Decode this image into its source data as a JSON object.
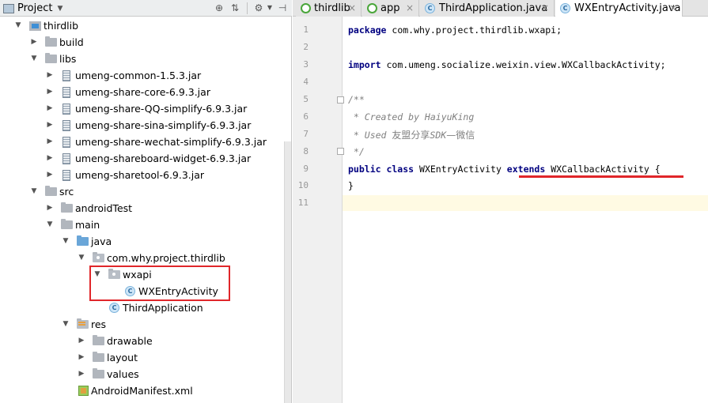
{
  "panel": {
    "title": "Project",
    "dropdown_icon": "caret-down-icon",
    "tools": [
      "target-icon",
      "collapse-icon",
      "gear-icon",
      "hide-icon"
    ]
  },
  "tree": [
    {
      "label": "thirdlib",
      "icon": "module-icon",
      "arrow": "expanded"
    },
    {
      "label": "build",
      "icon": "folder-icon",
      "arrow": "collapsed"
    },
    {
      "label": "libs",
      "icon": "folder-icon",
      "arrow": "expanded"
    },
    {
      "label": "umeng-common-1.5.3.jar",
      "icon": "jar-icon",
      "arrow": "collapsed"
    },
    {
      "label": "umeng-share-core-6.9.3.jar",
      "icon": "jar-icon",
      "arrow": "collapsed"
    },
    {
      "label": "umeng-share-QQ-simplify-6.9.3.jar",
      "icon": "jar-icon",
      "arrow": "collapsed"
    },
    {
      "label": "umeng-share-sina-simplify-6.9.3.jar",
      "icon": "jar-icon",
      "arrow": "collapsed"
    },
    {
      "label": "umeng-share-wechat-simplify-6.9.3.jar",
      "icon": "jar-icon",
      "arrow": "collapsed"
    },
    {
      "label": "umeng-shareboard-widget-6.9.3.jar",
      "icon": "jar-icon",
      "arrow": "collapsed"
    },
    {
      "label": "umeng-sharetool-6.9.3.jar",
      "icon": "jar-icon",
      "arrow": "collapsed"
    },
    {
      "label": "src",
      "icon": "folder-icon",
      "arrow": "expanded"
    },
    {
      "label": "androidTest",
      "icon": "folder-icon",
      "arrow": "collapsed"
    },
    {
      "label": "main",
      "icon": "folder-icon",
      "arrow": "expanded"
    },
    {
      "label": "java",
      "icon": "source-folder-icon",
      "arrow": "expanded"
    },
    {
      "label": "com.why.project.thirdlib",
      "icon": "package-icon",
      "arrow": "expanded"
    },
    {
      "label": "wxapi",
      "icon": "package-icon",
      "arrow": "expanded"
    },
    {
      "label": "WXEntryActivity",
      "icon": "class-icon",
      "arrow": "none"
    },
    {
      "label": "ThirdApplication",
      "icon": "class-icon",
      "arrow": "none"
    },
    {
      "label": "res",
      "icon": "resource-folder-icon",
      "arrow": "expanded"
    },
    {
      "label": "drawable",
      "icon": "folder-icon",
      "arrow": "collapsed"
    },
    {
      "label": "layout",
      "icon": "folder-icon",
      "arrow": "collapsed"
    },
    {
      "label": "values",
      "icon": "folder-icon",
      "arrow": "collapsed"
    },
    {
      "label": "AndroidManifest.xml",
      "icon": "manifest-icon",
      "arrow": "none"
    }
  ],
  "tabs": [
    {
      "label": "thirdlib",
      "icon": "module-tab-icon",
      "active": false
    },
    {
      "label": "app",
      "icon": "module-tab-icon",
      "active": false
    },
    {
      "label": "ThirdApplication.java",
      "icon": "class-icon",
      "active": false
    },
    {
      "label": "WXEntryActivity.java",
      "icon": "class-icon",
      "active": true
    }
  ],
  "code": {
    "line_numbers": [
      "1",
      "2",
      "3",
      "4",
      "5",
      "6",
      "7",
      "8",
      "9",
      "10",
      "11"
    ],
    "l1_kw": "package",
    "l1_rest": " com.why.project.thirdlib.wxapi;",
    "l3_kw": "import",
    "l3_rest": " com.umeng.socialize.weixin.view.WXCallbackActivity;",
    "l5": "/**",
    "l6": " * Created by HaiyuKing",
    "l7_a": " * Used ",
    "l7_cn": "友盟分享",
    "l7_b": "SDK",
    "l7_cn2": "—微信",
    "l8": " */",
    "l9_kw1": "public class",
    "l9_name": " WXEntryActivity ",
    "l9_kw2": "extends",
    "l9_rest": " WXCallbackActivity {",
    "l10": "}"
  },
  "colors": {
    "highlight": "#e0262a",
    "keyword": "#000080",
    "comment": "#808080"
  }
}
